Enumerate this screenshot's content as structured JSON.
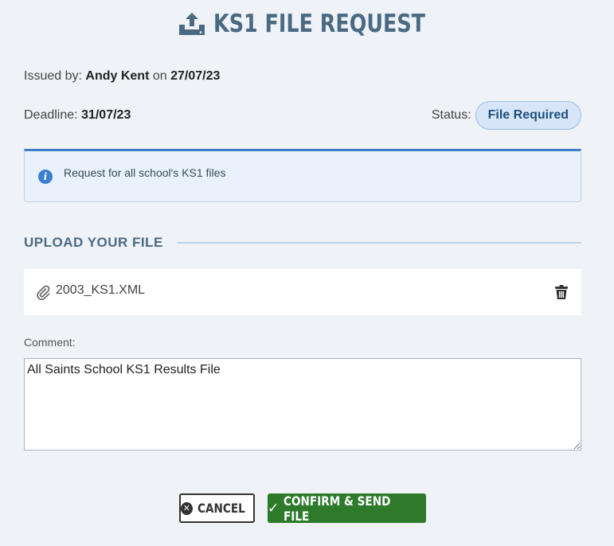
{
  "header": {
    "title": "KS1 FILE REQUEST",
    "icon": "upload-tray-icon"
  },
  "issued": {
    "prefix": "Issued by:",
    "name": "Andy Kent",
    "on": "on",
    "date": "27/07/23"
  },
  "deadline": {
    "label": "Deadline:",
    "date": "31/07/23"
  },
  "status": {
    "label": "Status:",
    "value": "File Required"
  },
  "info": {
    "icon": "info-icon",
    "text": "Request for all school's KS1 files"
  },
  "upload": {
    "heading": "UPLOAD YOUR FILE",
    "file_name": "2003_KS1.XML",
    "file_icon": "paperclip-icon",
    "delete_icon": "trash-icon"
  },
  "comment": {
    "label": "Comment:",
    "value": "All Saints School KS1 Results File"
  },
  "actions": {
    "cancel_label": "CANCEL",
    "confirm_label": "CONFIRM & SEND FILE"
  },
  "colors": {
    "background": "#eff2f7",
    "title": "#4a6a84",
    "info_accent": "#3c7fc8",
    "status_badge_bg": "#d6e6f8",
    "confirm_button": "#2e7a2b"
  }
}
